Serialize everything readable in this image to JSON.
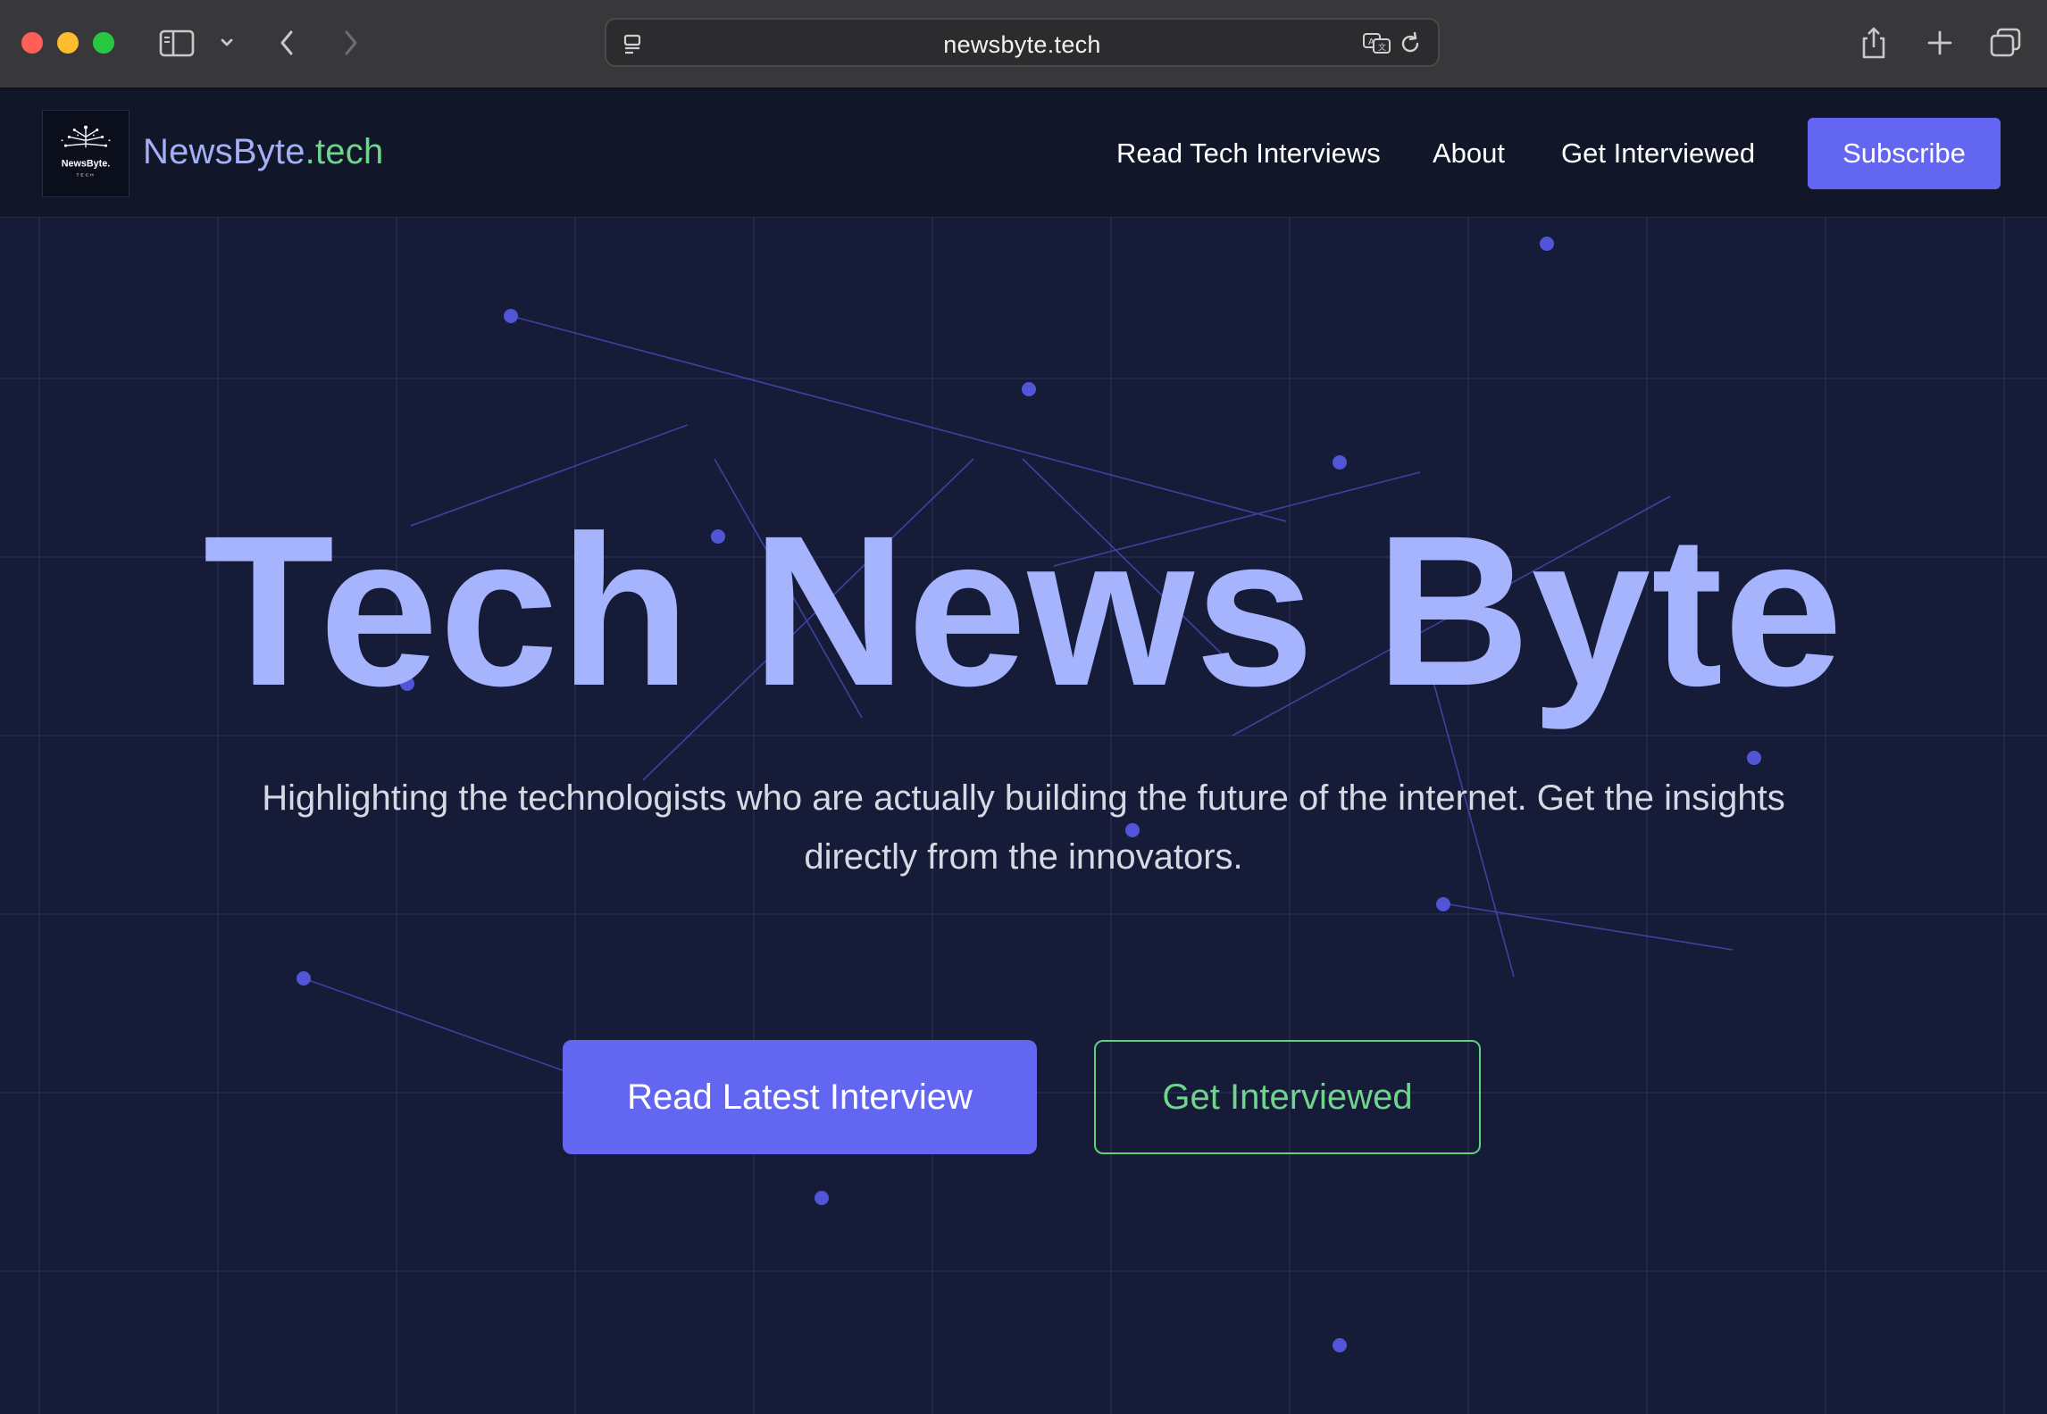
{
  "browser": {
    "url": "newsbyte.tech",
    "icons": [
      "sidebar-icon",
      "chevron-down-icon",
      "back-icon",
      "forward-icon",
      "page-menu-icon",
      "translate-icon",
      "reload-icon",
      "share-icon",
      "new-tab-icon",
      "tab-overview-icon"
    ]
  },
  "nav": {
    "logo_text": "NewsByte",
    "logo_tld": ".tech",
    "logo_badge": "NewsByte.",
    "logo_badge_sub": "TECH",
    "links": [
      "Read Tech Interviews",
      "About",
      "Get Interviewed"
    ],
    "subscribe": "Subscribe"
  },
  "hero": {
    "title": "Tech News Byte",
    "subtitle": "Highlighting the technologists who are actually building the future of the internet. Get the insights directly from the innovators.",
    "primary_cta": "Read Latest Interview",
    "secondary_cta": "Get Interviewed"
  },
  "colors": {
    "background": "#161b38",
    "accent": "#6366f1",
    "title": "#a5b4fc",
    "green": "#6fd58c",
    "dots": "#5156d8"
  }
}
